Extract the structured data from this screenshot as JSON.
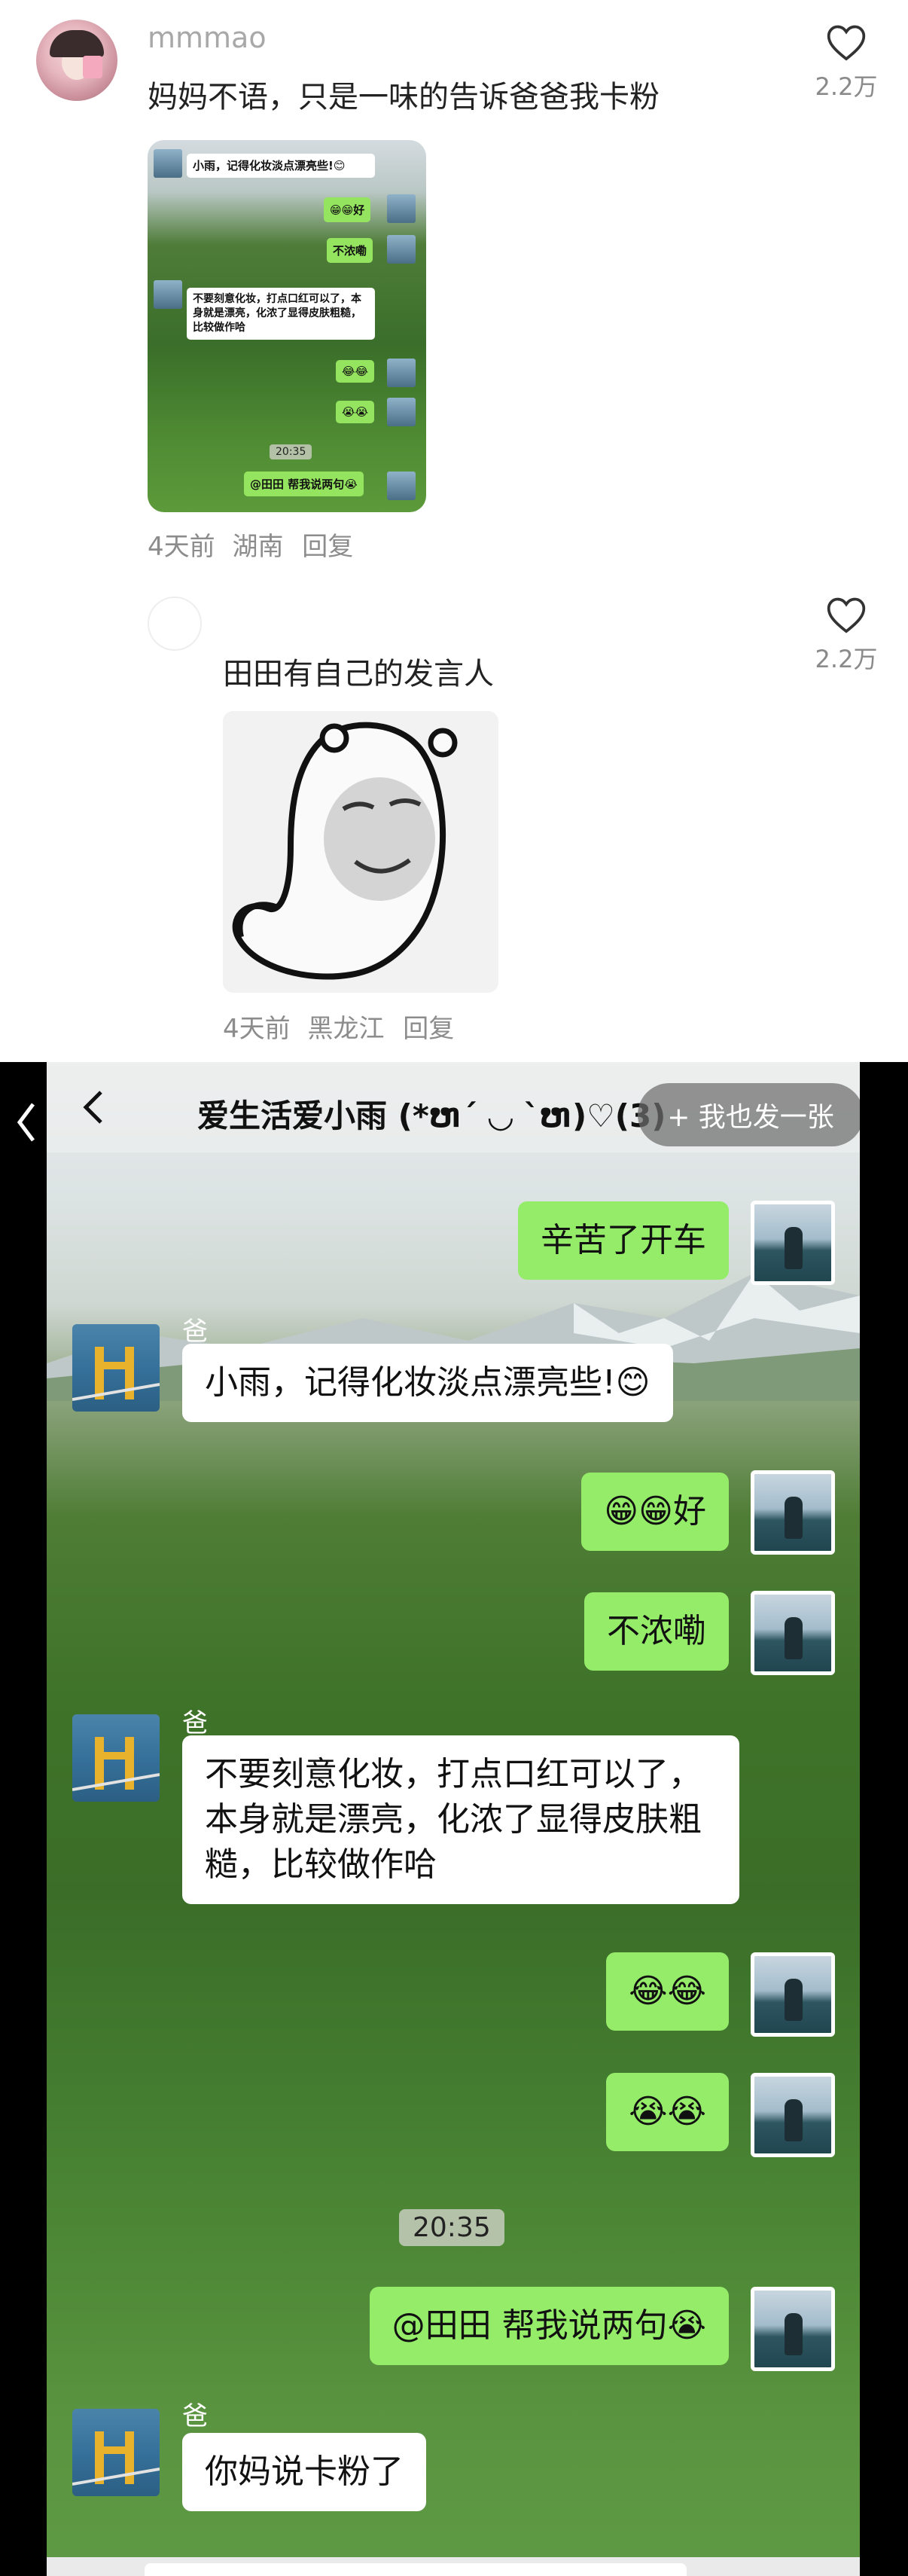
{
  "comments": [
    {
      "username": "mmmao",
      "text": "妈妈不语，只是一味的告诉爸爸我卡粉",
      "likes": "2.2万",
      "meta_time": "4天前",
      "meta_location": "湖南",
      "reply_label": "回复",
      "thumbnail": {
        "bubbles": [
          "小雨，记得化妆淡点漂亮些!😊",
          "😁😁好",
          "不浓嘞",
          "不要刻意化妆，打点口红可以了，本身就是漂亮，化浓了显得皮肤粗糙，比较做作哈",
          "😂😂",
          "😭😭",
          "@田田 帮我说两句😭"
        ],
        "time": "20:35"
      }
    },
    {
      "username": "",
      "text": "田田有自己的发言人",
      "likes": "2.2万",
      "meta_time": "4天前",
      "meta_location": "黑龙江",
      "reply_label": "回复"
    }
  ],
  "chat": {
    "title": "爱生活爱小雨 (*ຫ´ ◡ `ຫ)♡(3)",
    "send_button": "+ 我也发一张",
    "sender_name": "爸",
    "time_divider": "20:35",
    "messages": [
      {
        "side": "right",
        "text": "辛苦了开车"
      },
      {
        "side": "left",
        "text": "小雨，记得化妆淡点漂亮些!😊"
      },
      {
        "side": "right",
        "text": "😁😁好"
      },
      {
        "side": "right",
        "text": "不浓嘞"
      },
      {
        "side": "left",
        "text": "不要刻意化妆，打点口红可以了，本身就是漂亮，化浓了显得皮肤粗糙，比较做作哈"
      },
      {
        "side": "right",
        "text": "😂😂"
      },
      {
        "side": "right",
        "text": "😭😭"
      },
      {
        "side": "right",
        "text": "@田田 帮我说两句😭"
      },
      {
        "side": "left",
        "text": "你妈说卡粉了"
      }
    ]
  },
  "icons": {
    "like": "heart-outline-icon",
    "back": "chevron-left-icon"
  },
  "colors": {
    "wechat_green": "#95ec69",
    "meta_gray": "#8c8c8c"
  }
}
